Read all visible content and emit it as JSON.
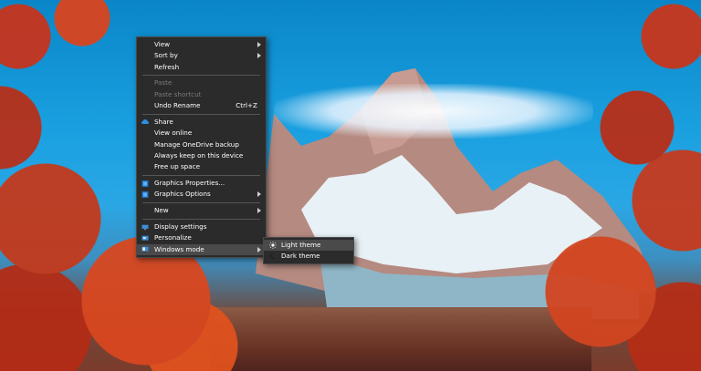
{
  "context_menu": {
    "items": [
      {
        "label": "View",
        "submenu": true
      },
      {
        "label": "Sort by",
        "submenu": true
      },
      {
        "label": "Refresh"
      },
      {
        "label": "Paste",
        "disabled": true
      },
      {
        "label": "Paste shortcut",
        "disabled": true
      },
      {
        "label": "Undo Rename",
        "shortcut": "Ctrl+Z"
      },
      {
        "label": "Share",
        "icon": "onedrive-cloud-icon"
      },
      {
        "label": "View online"
      },
      {
        "label": "Manage OneDrive backup"
      },
      {
        "label": "Always keep on this device"
      },
      {
        "label": "Free up space"
      },
      {
        "label": "Graphics Properties...",
        "icon": "intel-graphics-icon"
      },
      {
        "label": "Graphics Options",
        "icon": "intel-graphics-icon",
        "submenu": true
      },
      {
        "label": "New",
        "submenu": true
      },
      {
        "label": "Display settings",
        "icon": "display-icon"
      },
      {
        "label": "Personalize",
        "icon": "personalize-icon"
      },
      {
        "label": "Windows mode",
        "icon": "windows-mode-icon",
        "submenu": true,
        "highlighted": true
      }
    ]
  },
  "windows_mode_submenu": {
    "items": [
      {
        "label": "Light theme",
        "icon": "sun-icon",
        "highlighted": true
      },
      {
        "label": "Dark theme",
        "icon": "moon-icon"
      }
    ]
  },
  "colors": {
    "menu_bg": "#2b2b2b",
    "highlight": "#4a4a4a",
    "disabled_text": "#7a7a7a",
    "onedrive_blue": "#2d8fe0"
  }
}
